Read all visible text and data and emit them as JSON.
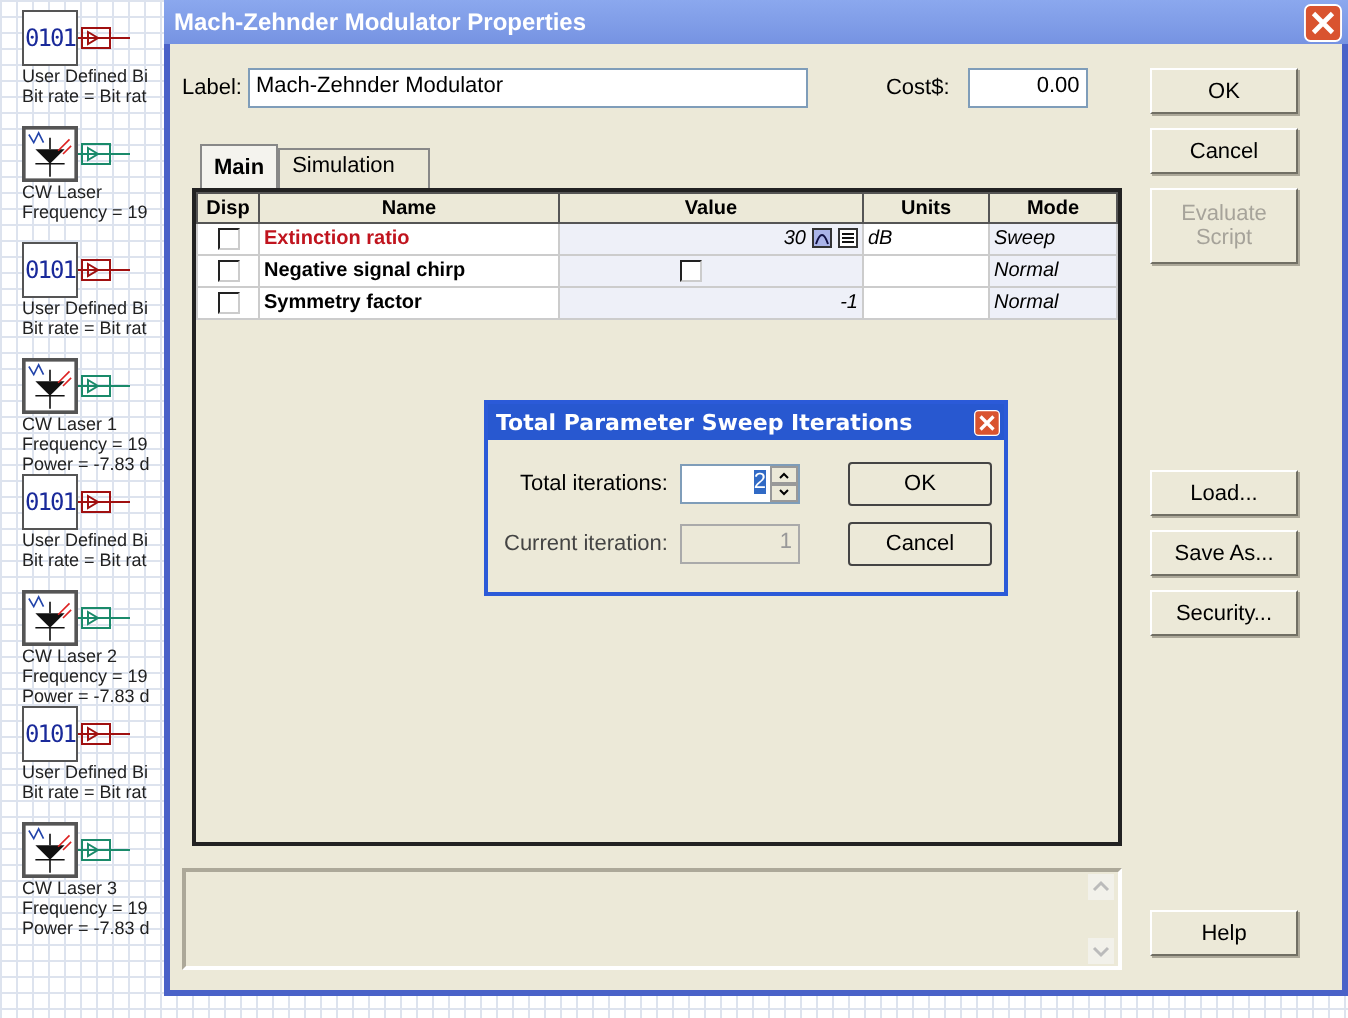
{
  "canvas": {
    "components": [
      {
        "kind": "bits",
        "glyph": "0101",
        "lines": [
          "User Defined Bi",
          "Bit rate = Bit rat"
        ]
      },
      {
        "kind": "laser",
        "lines": [
          "CW Laser",
          "Frequency = 19"
        ]
      },
      {
        "kind": "bits",
        "glyph": "0101",
        "lines": [
          "User Defined Bi",
          "Bit rate = Bit rat"
        ]
      },
      {
        "kind": "laser",
        "lines": [
          "CW Laser 1",
          "Frequency = 19",
          "Power = -7.83  d"
        ]
      },
      {
        "kind": "bits",
        "glyph": "0101",
        "lines": [
          "User Defined Bi",
          "Bit rate = Bit rat"
        ]
      },
      {
        "kind": "laser",
        "lines": [
          "CW Laser 2",
          "Frequency = 19",
          "Power = -7.83  d"
        ]
      },
      {
        "kind": "bits",
        "glyph": "0101",
        "lines": [
          "User Defined Bi",
          "Bit rate = Bit rat"
        ]
      },
      {
        "kind": "laser",
        "lines": [
          "CW Laser 3",
          "Frequency = 19",
          "Power = -7.83  d"
        ]
      }
    ]
  },
  "window": {
    "title": "Mach-Zehnder Modulator Properties"
  },
  "label_field": {
    "label": "Label:",
    "value": "Mach-Zehnder Modulator"
  },
  "cost_field": {
    "label": "Cost$:",
    "value": "0.00"
  },
  "tabs": [
    {
      "label": "Main",
      "selected": true
    },
    {
      "label": "Simulation",
      "selected": false
    }
  ],
  "table": {
    "columns": [
      "Disp",
      "Name",
      "Value",
      "Units",
      "Mode"
    ],
    "rows": [
      {
        "disp": false,
        "name": "Extinction ratio",
        "highlighted": true,
        "kind": "number",
        "value": "30",
        "units": "dB",
        "mode": "Sweep"
      },
      {
        "disp": false,
        "name": "Negative signal chirp",
        "highlighted": false,
        "kind": "checkbox",
        "checked": false,
        "units": "",
        "mode": "Normal"
      },
      {
        "disp": false,
        "name": "Symmetry factor",
        "highlighted": false,
        "kind": "number",
        "value": "-1",
        "units": "",
        "mode": "Normal"
      }
    ]
  },
  "buttons_top": [
    {
      "label": "OK",
      "disabled": false
    },
    {
      "label": "Cancel",
      "disabled": false
    },
    {
      "label": "Evaluate Script",
      "disabled": true
    }
  ],
  "buttons_middle": [
    {
      "label": "Load...",
      "disabled": false
    },
    {
      "label": "Save As...",
      "disabled": false
    },
    {
      "label": "Security...",
      "disabled": false
    }
  ],
  "buttons_bottom": [
    {
      "label": "Help",
      "disabled": false
    }
  ],
  "sweep_dialog": {
    "title": "Total Parameter Sweep Iterations",
    "total_label": "Total iterations:",
    "total_value": "2",
    "current_label": "Current iteration:",
    "current_value": "1",
    "buttons": [
      "OK",
      "Cancel"
    ]
  }
}
